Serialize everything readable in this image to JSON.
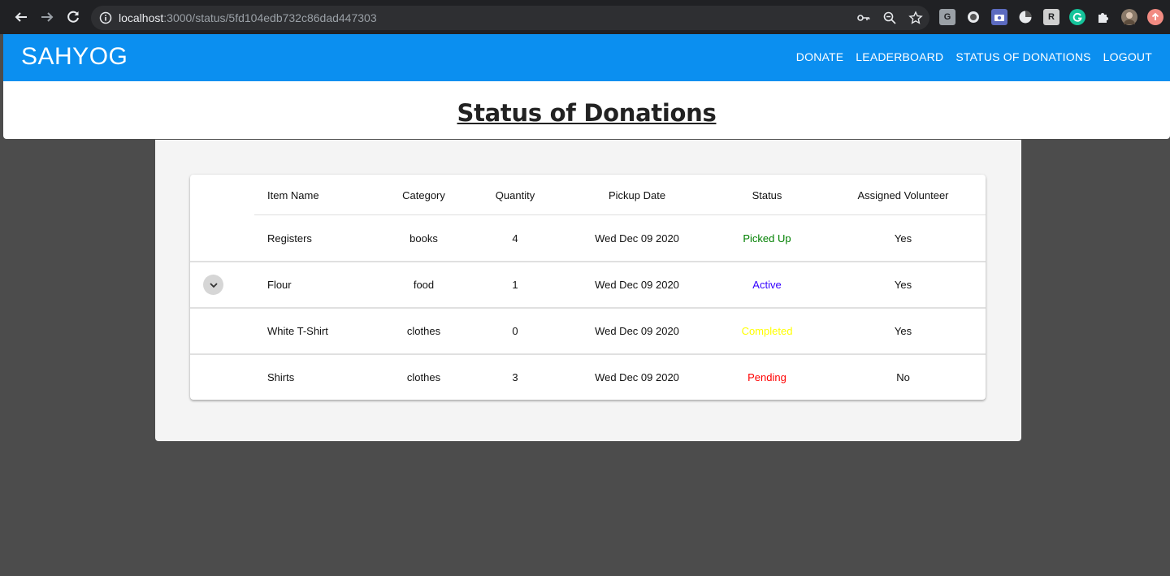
{
  "browser": {
    "url_host": "localhost",
    "url_path": ":3000/status/5fd104edb732c86dad447303",
    "extensions": [
      "G",
      "",
      "",
      "",
      "R",
      "",
      "",
      "",
      ""
    ]
  },
  "appbar": {
    "brand": "SAHYOG",
    "nav": [
      "DONATE",
      "LEADERBOARD",
      "STATUS OF DONATIONS",
      "LOGOUT"
    ]
  },
  "page": {
    "title": "Status of Donations"
  },
  "table": {
    "headers": [
      "Item Name",
      "Category",
      "Quantity",
      "Pickup Date",
      "Status",
      "Assigned Volunteer"
    ],
    "rows": [
      {
        "item": "Registers",
        "category": "books",
        "quantity": "4",
        "date": "Wed Dec 09 2020",
        "status": "Picked Up",
        "status_color": "#008000",
        "volunteer": "Yes",
        "expandable": false
      },
      {
        "item": "Flour",
        "category": "food",
        "quantity": "1",
        "date": "Wed Dec 09 2020",
        "status": "Active",
        "status_color": "#3300ff",
        "volunteer": "Yes",
        "expandable": true
      },
      {
        "item": "White T-Shirt",
        "category": "clothes",
        "quantity": "0",
        "date": "Wed Dec 09 2020",
        "status": "Completed",
        "status_color": "#ffff00",
        "volunteer": "Yes",
        "expandable": false
      },
      {
        "item": "Shirts",
        "category": "clothes",
        "quantity": "3",
        "date": "Wed Dec 09 2020",
        "status": "Pending",
        "status_color": "#ff0000",
        "volunteer": "No",
        "expandable": false
      }
    ]
  },
  "colors": {
    "appbar": "#0b8ff0",
    "background": "#4c4c4c",
    "card": "#f4f4f4"
  }
}
